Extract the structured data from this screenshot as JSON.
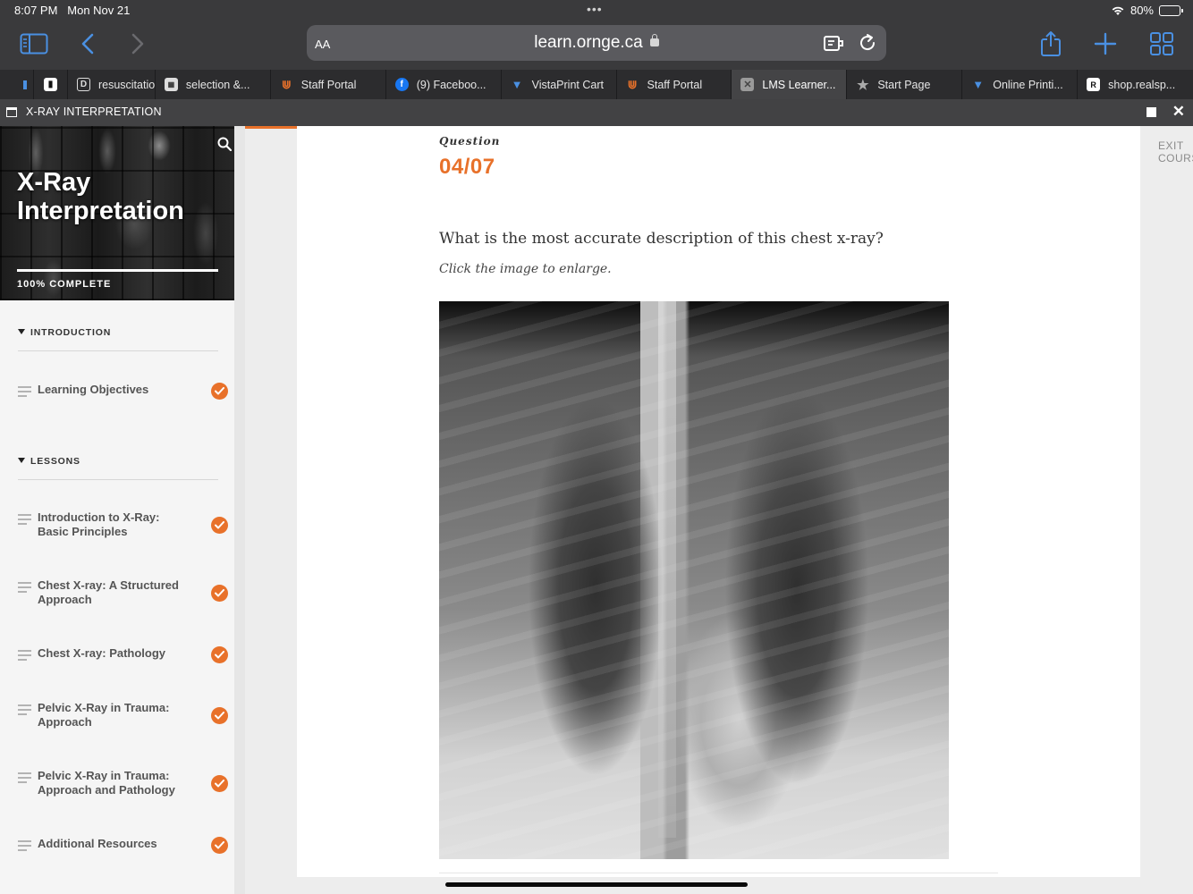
{
  "status_bar": {
    "time": "8:07 PM",
    "date": "Mon Nov 21",
    "battery": "80%",
    "battery_level": 0.8
  },
  "toolbar": {
    "text_size_label": "AA",
    "url": "learn.ornge.ca"
  },
  "tabs": [
    {
      "label": "",
      "favicon": "partial-tab"
    },
    {
      "label": "",
      "favicon": "tab-dark-icon"
    },
    {
      "label": "resuscitatio",
      "favicon": "d-icon"
    },
    {
      "label": "selection &...",
      "favicon": "image-icon"
    },
    {
      "label": "Staff Portal",
      "favicon": "ornge-logo"
    },
    {
      "label": "(9) Faceboo...",
      "favicon": "facebook-icon"
    },
    {
      "label": "VistaPrint Cart",
      "favicon": "vistaprint-icon"
    },
    {
      "label": "Staff Portal",
      "favicon": "ornge-logo"
    },
    {
      "label": "LMS Learner...",
      "favicon": "close-icon",
      "active": true
    },
    {
      "label": "Start Page",
      "favicon": "star-icon"
    },
    {
      "label": "Online Printi...",
      "favicon": "vistaprint-icon"
    },
    {
      "label": "shop.realsp...",
      "favicon": "realsp-icon"
    }
  ],
  "window": {
    "title": "X-RAY INTERPRETATION"
  },
  "sidebar": {
    "course_title": "X-Ray Interpretation",
    "progress_label": "100% COMPLETE",
    "progress": 1.0,
    "sections": [
      {
        "label": "INTRODUCTION",
        "items": [
          {
            "label": "Learning Objectives",
            "complete": true
          }
        ]
      },
      {
        "label": "LESSONS",
        "items": [
          {
            "label": "Introduction to X-Ray: Basic Principles",
            "complete": true
          },
          {
            "label": "Chest X-ray: A Structured Approach",
            "complete": true
          },
          {
            "label": "Chest X-ray: Pathology",
            "complete": true
          },
          {
            "label": "Pelvic X-Ray in Trauma: Approach",
            "complete": true
          },
          {
            "label": "Pelvic X-Ray in Trauma: Approach and Pathology",
            "complete": true
          },
          {
            "label": "Additional Resources",
            "complete": true
          }
        ]
      }
    ]
  },
  "main": {
    "eyebrow": "Question",
    "question_number": "04/07",
    "question": "What is the most accurate description of this chest x-ray?",
    "hint": "Click the image to enlarge.",
    "exit_label": "EXIT COURSE",
    "progress": 0.57
  },
  "colors": {
    "accent": "#e8712a",
    "chrome": "#3a3a3c",
    "link_blue": "#4a90e2"
  }
}
